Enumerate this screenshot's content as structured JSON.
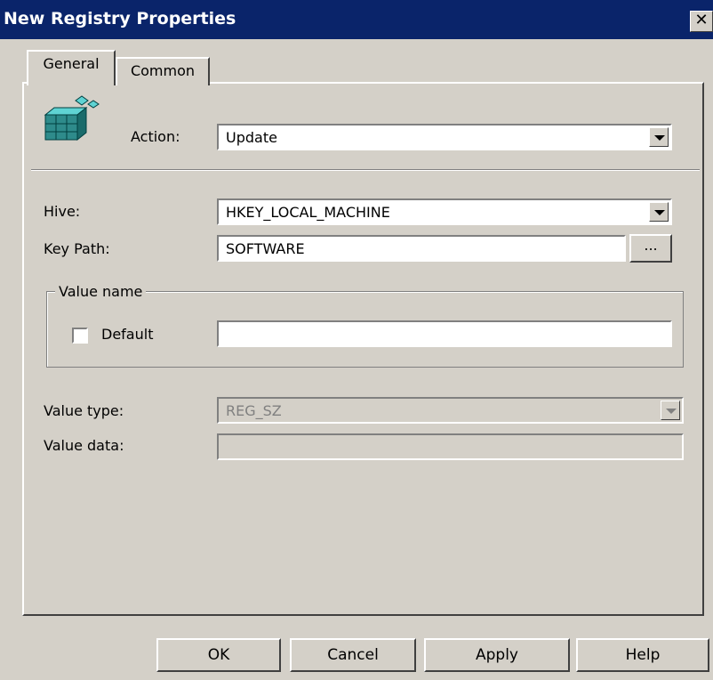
{
  "window": {
    "title": "New Registry Properties",
    "close_label": "✕"
  },
  "tabs": [
    {
      "label": "General"
    },
    {
      "label": "Common"
    }
  ],
  "form": {
    "action_label": "Action:",
    "action_value": "Update",
    "hive_label": "Hive:",
    "hive_value": "HKEY_LOCAL_MACHINE",
    "key_path_label": "Key Path:",
    "key_path_value": "SOFTWARE",
    "browse_label": "...",
    "value_name_legend": "Value name",
    "default_label": "Default",
    "default_checked": false,
    "value_name_value": "",
    "value_type_label": "Value type:",
    "value_type_value": "REG_SZ",
    "value_data_label": "Value data:",
    "value_data_value": ""
  },
  "buttons": {
    "ok": "OK",
    "cancel": "Cancel",
    "apply": "Apply",
    "help": "Help"
  },
  "icons": {
    "action_icon": "registry-cubes-icon"
  },
  "colors": {
    "titlebar": "#0a246a",
    "face": "#d4d0c8",
    "disabled_text": "#808080"
  }
}
